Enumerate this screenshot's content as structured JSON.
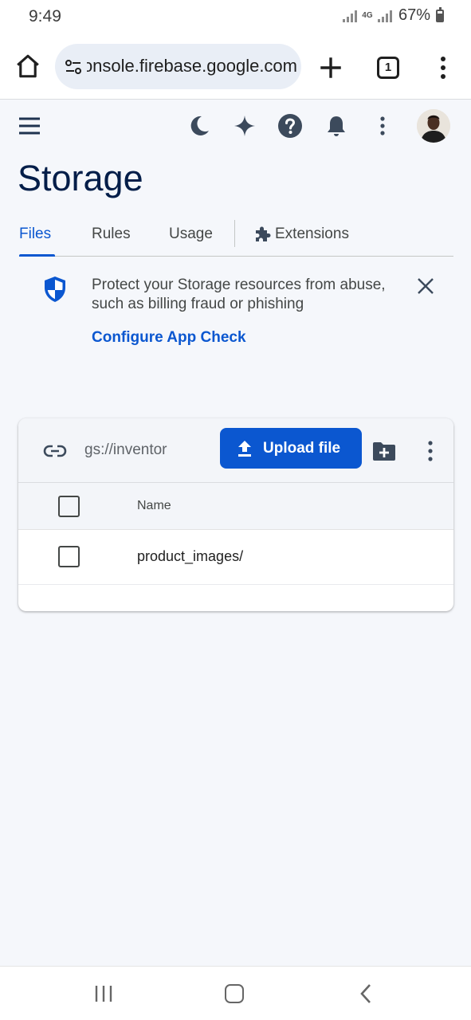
{
  "status_bar": {
    "time": "9:49",
    "network": "4G",
    "battery": "67%"
  },
  "browser": {
    "url": "console.firebase.google.com",
    "tab_count": "1"
  },
  "page": {
    "title": "Storage",
    "tabs": [
      {
        "label": "Files",
        "active": true
      },
      {
        "label": "Rules",
        "active": false
      },
      {
        "label": "Usage",
        "active": false
      },
      {
        "label": "Extensions",
        "active": false
      }
    ]
  },
  "banner": {
    "message": "Protect your Storage resources from abuse, such as billing fraud or phishing",
    "link": "Configure App Check"
  },
  "storage": {
    "bucket": "gs://inventor",
    "upload_label": "Upload file",
    "column_name": "Name",
    "rows": [
      {
        "name": "product_images/"
      }
    ]
  },
  "colors": {
    "accent": "#0b57d0",
    "title": "#041e49",
    "icon": "#3c4a5c"
  }
}
